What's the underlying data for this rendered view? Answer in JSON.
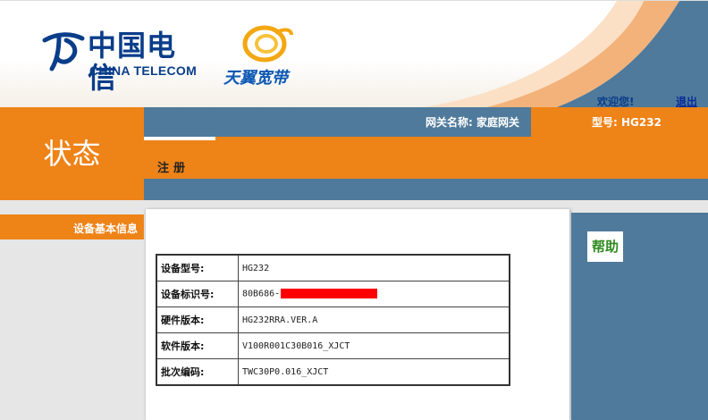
{
  "header": {
    "brand_cn": "中国电信",
    "brand_en": "CHINA TELECOM",
    "broadband_brand": "天翼宽带",
    "welcome_text": "欢迎您!",
    "logout_label": "退出"
  },
  "status_title": "状态",
  "info_bar": {
    "gateway_name": "网关名称: 家庭网关",
    "model": "型号: HG232"
  },
  "tabs": [
    {
      "label": "注册",
      "selected": true
    }
  ],
  "sidebar": {
    "items": [
      {
        "label": "设备基本信息",
        "selected": true
      }
    ]
  },
  "device_info": {
    "rows": [
      {
        "label": "设备型号:",
        "value": "HG232"
      },
      {
        "label": "设备标识号:",
        "value": "80B686-",
        "redacted": true
      },
      {
        "label": "硬件版本:",
        "value": "HG232RRA.VER.A"
      },
      {
        "label": "软件版本:",
        "value": "V100R001C30B016_XJCT"
      },
      {
        "label": "批次编码:",
        "value": "TWC30P0.016_XJCT"
      }
    ]
  },
  "help": {
    "title": "帮助"
  },
  "colors": {
    "orange": "#ee8318",
    "steel_blue": "#4f7a9b",
    "brand_blue": "#0a3d8a",
    "help_green": "#2e8b1e",
    "redaction": "#ff0000"
  }
}
